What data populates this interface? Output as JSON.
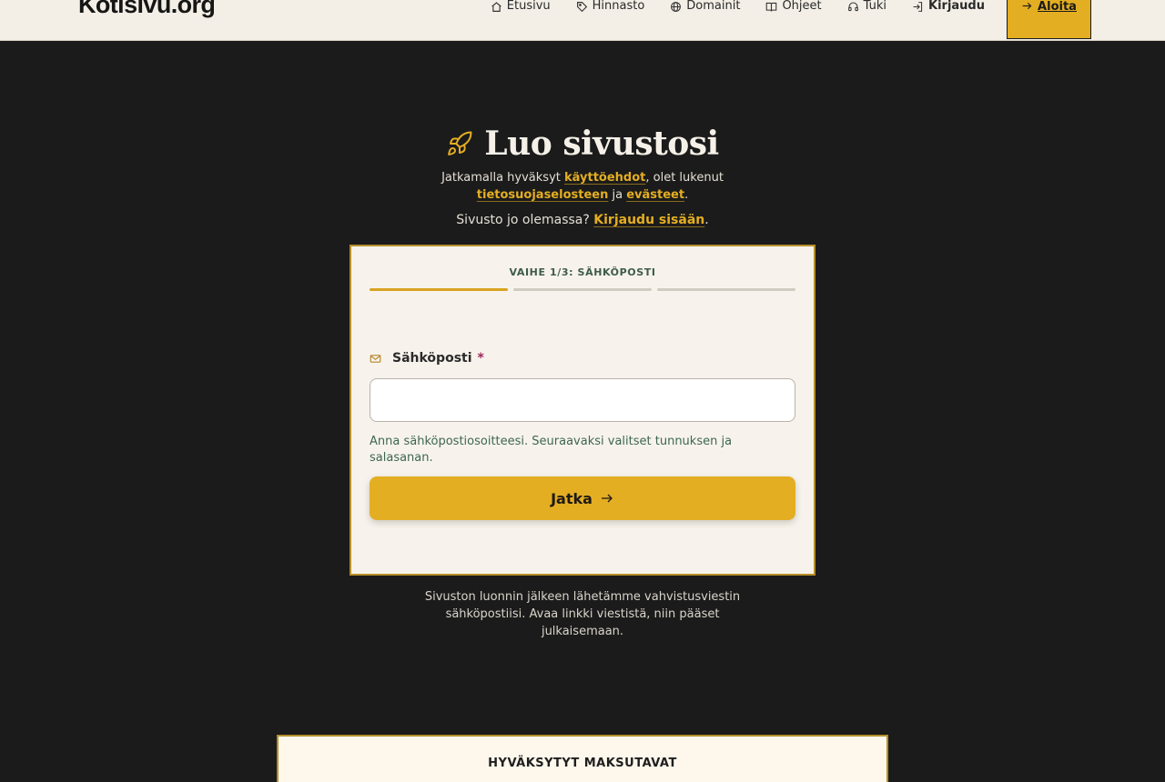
{
  "header": {
    "logo": "Kotisivu.org",
    "nav": [
      {
        "label": "Etusivu",
        "icon": "home-icon"
      },
      {
        "label": "Hinnasto",
        "icon": "tag-icon"
      },
      {
        "label": "Domainit",
        "icon": "globe-icon"
      },
      {
        "label": "Ohjeet",
        "icon": "book-icon"
      },
      {
        "label": "Tuki",
        "icon": "headset-icon"
      },
      {
        "label": "Kirjaudu",
        "icon": "login-icon"
      }
    ],
    "cta_label": "Aloita"
  },
  "hero": {
    "title": "Luo sivustosi",
    "terms_prefix": "Jatkamalla hyväksyt ",
    "terms_link": "käyttöehdot",
    "terms_mid": ", olet lukenut",
    "privacy_link": "tietosuojaselosteen",
    "and": " ja ",
    "cookies_link": "evästeet",
    "period": ".",
    "already_text": "Sivusto jo olemassa? ",
    "already_link": "Kirjaudu sisään",
    "already_period": "."
  },
  "form": {
    "step_label": "VAIHE 1/3: SÄHKÖPOSTI",
    "steps_total": 3,
    "step_current": 1,
    "email_label": "Sähköposti",
    "required_mark": "*",
    "email_value": "",
    "hint": "Anna sähköpostiosoitteesi. Seuraavaksi valitset tunnuksen ja salasanan.",
    "submit_label": "Jatka"
  },
  "after_note": "Sivuston luonnin jälkeen lähetämme vahvistusviestin sähköpostiisi. Avaa linkki viestistä, niin pääset julkaisemaan.",
  "payments": {
    "title": "HYVÄKSYTYT MAKSUTAVAT"
  },
  "colors": {
    "accent": "#e4ae23",
    "background": "#1b1b1b",
    "header_bg": "#f3efe6",
    "card_bg": "#f7f3ec"
  }
}
